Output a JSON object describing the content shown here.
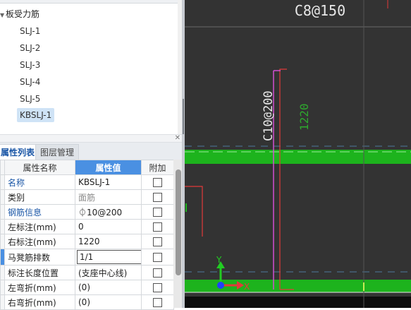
{
  "tree": {
    "root_label": "板受力筋",
    "items": [
      "SLJ-1",
      "SLJ-2",
      "SLJ-3",
      "SLJ-4",
      "SLJ-5",
      "KBSLJ-1"
    ],
    "selected": "KBSLJ-1"
  },
  "tabs": {
    "properties": "属性列表",
    "layers": "图层管理"
  },
  "grid": {
    "headers": {
      "name": "属性名称",
      "value": "属性值",
      "extra": "附加"
    },
    "rows": [
      {
        "name": "名称",
        "value": "KBSLJ-1"
      },
      {
        "name": "类别",
        "value": "面筋"
      },
      {
        "name": "钢筋信息",
        "value": "⏀10@200"
      },
      {
        "name": "左标注(mm)",
        "value": "0"
      },
      {
        "name": "右标注(mm)",
        "value": "1220"
      },
      {
        "name": "马凳筋排数",
        "value": "1/1"
      },
      {
        "name": "标注长度位置",
        "value": "(支座中心线)"
      },
      {
        "name": "左弯折(mm)",
        "value": "(0)"
      },
      {
        "name": "右弯折(mm)",
        "value": "(0)"
      }
    ]
  },
  "canvas": {
    "top_label": "C8@150",
    "vertical_label": "C10@200",
    "dim_label": "1220",
    "axis_y": "Y",
    "axis_x": "X",
    "colors": {
      "background": "#333333",
      "beam": "#1db31d",
      "rebar": "#d24fd2",
      "outline": "#e23a3a",
      "label": "#e8e8e8",
      "dim": "#2ea82e"
    }
  }
}
